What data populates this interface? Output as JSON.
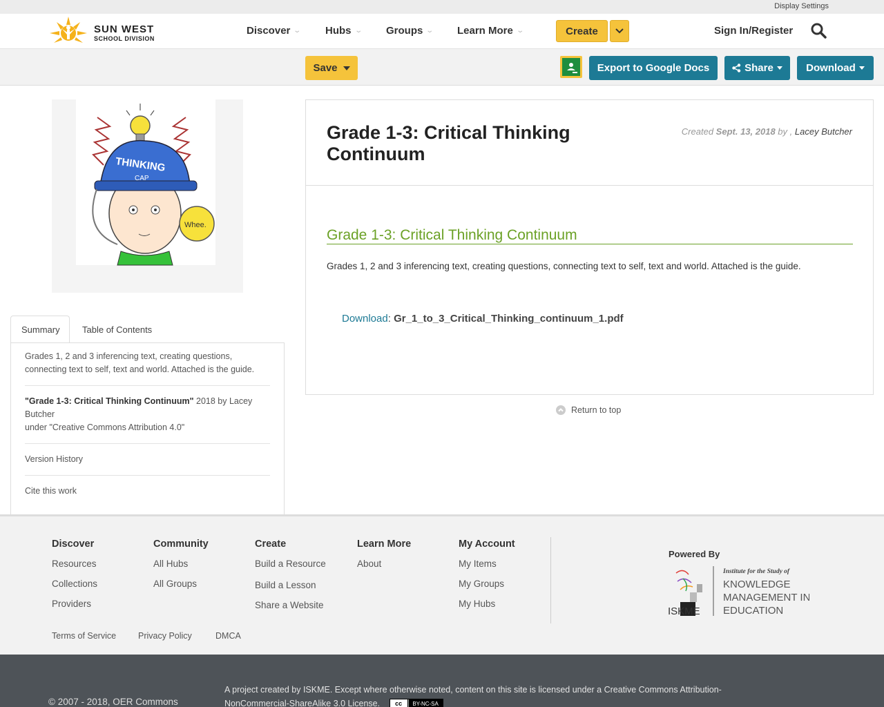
{
  "top_strip": {
    "display_settings": "Display Settings"
  },
  "header": {
    "logo_line1": "SUN WEST",
    "logo_line2": "SCHOOL DIVISION",
    "nav": [
      "Discover",
      "Hubs",
      "Groups",
      "Learn More"
    ],
    "create_label": "Create",
    "signin_label": "Sign In/Register"
  },
  "toolbar": {
    "save_label": "Save",
    "export_label": "Export to Google Docs",
    "share_label": "Share",
    "download_label": "Download"
  },
  "sidebar": {
    "tabs": [
      "Summary",
      "Table of Contents"
    ],
    "summary_text": "Grades 1, 2 and 3 inferencing text, creating questions, connecting text to self, text and world. Attached is the guide.",
    "attribution_title": "\"Grade 1-3: Critical Thinking Continuum\"",
    "attribution_rest": " 2018 by Lacey Butcher",
    "attribution_license": "under \"Creative Commons Attribution 4.0\"",
    "version_history": "Version History",
    "cite": "Cite this work"
  },
  "thumbnail": {
    "cap_text": "THINKING",
    "cap_sub": "CAP",
    "bubble_text": "Whee."
  },
  "resource": {
    "title": "Grade 1-3: Critical Thinking Continuum",
    "created_prefix": "Created",
    "created_date": "Sept. 13, 2018",
    "created_by": "by ,",
    "author": "Lacey Butcher",
    "section_title": "Grade 1-3: Critical Thinking Continuum",
    "description": "Grades 1, 2 and 3 inferencing text, creating questions, connecting text to self, text and world. Attached is the guide.",
    "download_link": "Download",
    "download_sep": ":",
    "download_file": "Gr_1_to_3_Critical_Thinking_continuum_1.pdf",
    "return_top": "Return to top"
  },
  "footer": {
    "columns": [
      {
        "heading": "Discover",
        "links": [
          "Resources",
          "Collections",
          "Providers"
        ]
      },
      {
        "heading": "Community",
        "links": [
          "All Hubs",
          "All Groups"
        ]
      },
      {
        "heading": "Create",
        "links": [
          "Build a Resource",
          "Build a Lesson",
          "Share a Website"
        ]
      },
      {
        "heading": "Learn More",
        "links": [
          "About"
        ]
      },
      {
        "heading": "My Account",
        "links": [
          "My Items",
          "My Groups",
          "My Hubs"
        ]
      }
    ],
    "powered_by": "Powered By",
    "iskme_line1": "Institute for the Study of",
    "iskme_line2": "KNOWLEDGE",
    "iskme_line3": "MANAGEMENT IN",
    "iskme_line4": "EDUCATION",
    "iskme_abbr": "ISKME",
    "legal": [
      "Terms of Service",
      "Privacy Policy",
      "DMCA"
    ]
  },
  "bottom": {
    "copyright": "© 2007 - 2018, OER Commons",
    "project_text": "A project created by ISKME. Except where otherwise noted, content on this site is licensed under a Creative Commons Attribution-NonCommercial-ShareAlike 3.0 License.",
    "cc_left": "cc",
    "cc_right": "BY-NC-SA"
  },
  "colors": {
    "accent_yellow": "#f5c33b",
    "teal": "#1d7a95",
    "green": "#6ba126",
    "footer_dark": "#4e5358"
  }
}
